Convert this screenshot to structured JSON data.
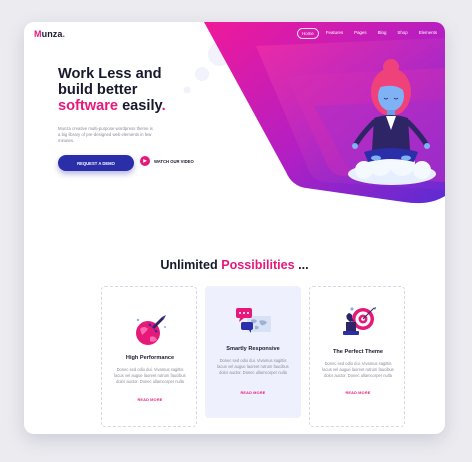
{
  "brand": {
    "logo": "Munza",
    "logo_dot": "."
  },
  "nav": {
    "items": [
      "Home",
      "Features",
      "Pages",
      "Blog",
      "Shop",
      "Elements"
    ],
    "active": "Home"
  },
  "hero": {
    "title_line1": "Work Less and",
    "title_line2": "build better",
    "title_accent": "software",
    "title_end": " easily",
    "title_dot": ".",
    "description": "Munza creative multi-purpose wordpress theme is a big library of pre-designed web elements in few minutes.",
    "primary_button": "REQUEST A DEMO",
    "video_button": "WATCH OUR VIDEO",
    "illustration": "meditating-woman-on-cloud"
  },
  "features": {
    "title_start": "Unlimited ",
    "title_accent": "Possibilities",
    "title_end": " ...",
    "cards": [
      {
        "icon": "rocket-globe-icon",
        "title": "High Performance",
        "description": "Donec sed odio dui. Vivamus sagittis lacus vel augue laoreet rutrum faucibus dolor auctor. Donec ullamcorper nulla",
        "link": "READ MORE"
      },
      {
        "icon": "chat-world-map-icon",
        "title": "Smartly Responsive",
        "description": "Donec sed odio dui. Vivamus sagittis lacus vel augue laoreet rutrum faucibus dolor auctor. Donec ullamcorper nulla",
        "link": "READ MORE"
      },
      {
        "icon": "chess-target-icon",
        "title": "The Perfect Theme",
        "description": "Donec sed odio dui. Vivamus sagittis lacus vel augue laoreet rutrum faucibus dolor auctor. Donec ullamcorper nulla",
        "link": "READ MORE"
      }
    ]
  },
  "colors": {
    "accent": "#e6197a",
    "primary": "#2a2ea8",
    "purple": "#6a2bd0",
    "dark": "#18182c"
  }
}
